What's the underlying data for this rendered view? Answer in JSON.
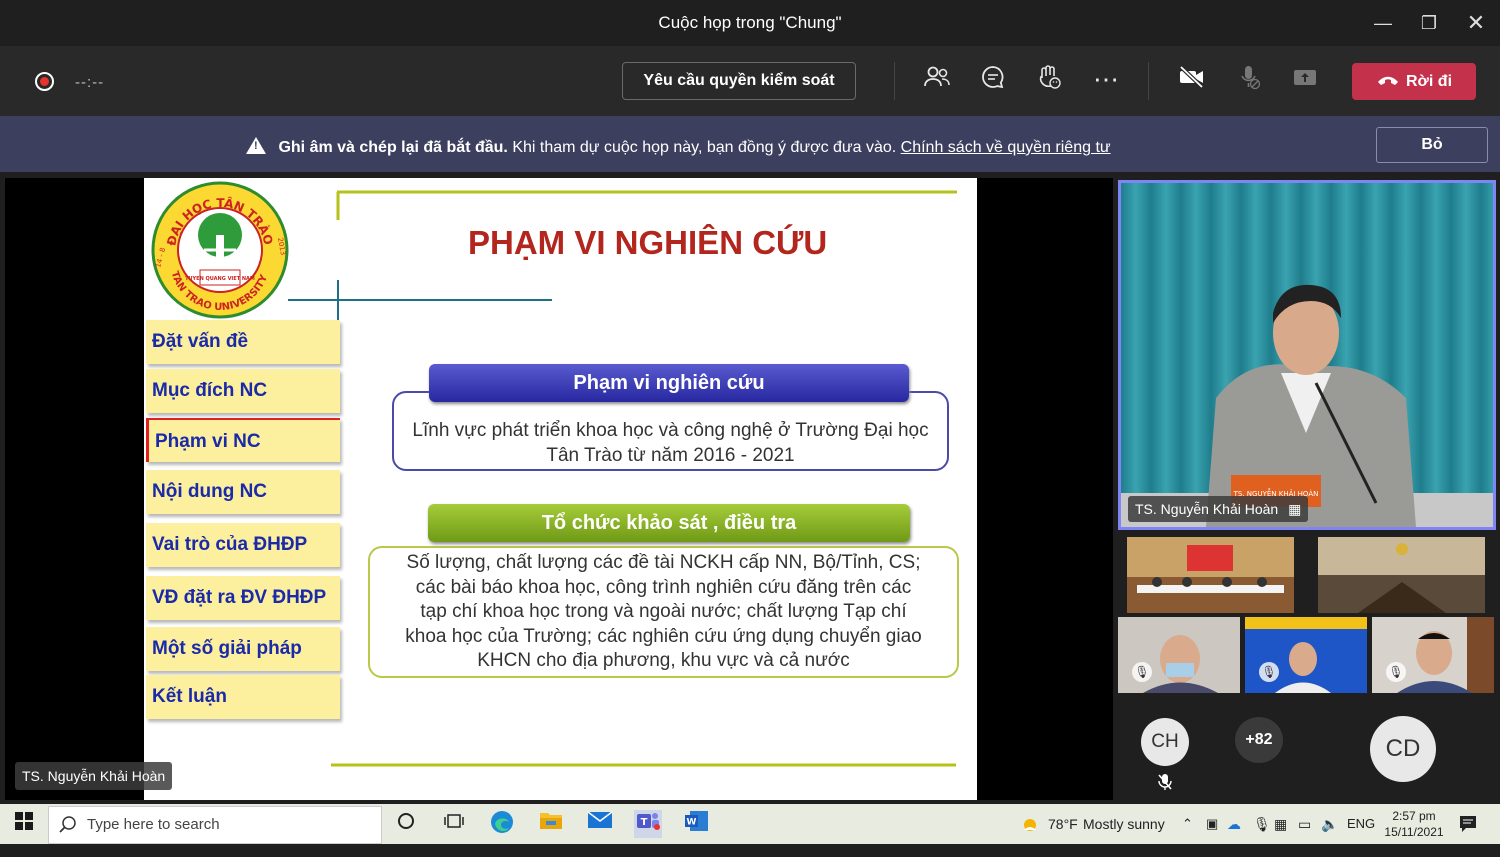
{
  "window": {
    "title": "Cuộc họp trong \"Chung\""
  },
  "toolbar": {
    "timer": "--:--",
    "request_control_label": "Yêu cầu quyền kiểm soát",
    "leave_label": "Rời đi",
    "icons": [
      "participants-icon",
      "chat-icon",
      "reactions-icon",
      "more-icon",
      "camera-off-icon",
      "mic-off-icon",
      "share-icon"
    ],
    "leave_color": "#c4314b"
  },
  "banner": {
    "bold_text": "Ghi âm và chép lại đã bắt đầu.",
    "text": "Khi tham dự cuộc họp này, bạn đồng ý được đưa vào.",
    "link_text": "Chính sách về quyền riêng tư",
    "dismiss_label": "Bỏ"
  },
  "slide": {
    "title": "PHẠM VI NGHIÊN CỨU",
    "menu": [
      "Đặt vấn đề",
      "Mục đích NC",
      "Phạm vi NC",
      "Nội dung NC",
      "Vai trò của ĐHĐP",
      "VĐ đặt ra ĐV ĐHĐP",
      "Một số giải pháp",
      "Kết luận"
    ],
    "active_menu_index": 2,
    "box1_header": "Phạm vi nghiên cứu",
    "box1_text": "Lĩnh vực phát triển khoa học và công nghệ ở Trường Đại học Tân Trào từ năm 2016 - 2021",
    "box2_header": "Tổ chức khảo sát , điều tra",
    "box2_text": "Số lượng, chất lượng các đề tài NCKH cấp NN, Bộ/Tỉnh, CS; các bài báo khoa học, công trình nghiên cứu đăng trên các tạp chí khoa học trong và ngoài nước; chất lượng Tạp chí khoa học của Trường; các nghiên cứu ứng dụng chuyển giao KHCN cho địa phương, khu vực và cả nước",
    "logo_ring_text": "ĐẠI HỌC TÂN TRÀO",
    "logo_ring_text_2": "TAN TRAO UNIVERSITY",
    "logo_side_left": "14 - 8",
    "logo_side_right": "2013",
    "logo_center_text": "TUYEN QUANG VIET NAM"
  },
  "presenter_tag": "TS. Nguyễn Khải Hoàn",
  "main_video": {
    "name": "TS. Nguyễn Khải Hoàn",
    "nameplate": "TS. NGUYỄN KHẢI HOÀN"
  },
  "participants": {
    "avatars": [
      "CH",
      "CD"
    ],
    "overflow": "+82"
  },
  "taskbar": {
    "search_placeholder": "Type here to search",
    "weather_temp": "78°F",
    "weather_text": "Mostly sunny",
    "language": "ENG",
    "time": "2:57 pm",
    "date": "15/11/2021"
  }
}
